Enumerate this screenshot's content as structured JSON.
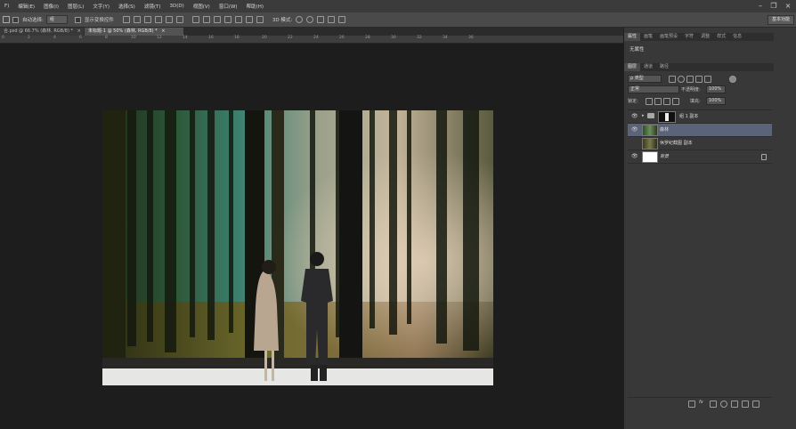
{
  "menu": {
    "items": [
      "F)",
      "编辑(E)",
      "图像(I)",
      "图层(L)",
      "文字(Y)",
      "选择(S)",
      "滤镜(T)",
      "3D(D)",
      "视图(V)",
      "窗口(W)",
      "帮助(H)"
    ],
    "minimize": "–",
    "restore": "❐",
    "close": "×"
  },
  "options": {
    "auto_select_label": "自动选择:",
    "auto_select_value": "组",
    "show_transform_label": "显示变换控件",
    "mode_3d_label": "3D 模式:",
    "workspace": "基本功能"
  },
  "doc_tabs": [
    {
      "label": "合.psd @ 66.7% (森林, RGB/8) *",
      "close": "×"
    },
    {
      "label": "未标题-1 @ 50% (森林, RGB/8) *",
      "close": "×"
    }
  ],
  "ruler": [
    "0",
    "2",
    "4",
    "6",
    "8",
    "10",
    "12",
    "14",
    "16",
    "18",
    "20",
    "22",
    "24",
    "26",
    "28",
    "30",
    "32",
    "34",
    "36"
  ],
  "properties_panel": {
    "tabs": [
      "属性",
      "画笔",
      "画笔预设",
      "字符",
      "调整",
      "样式",
      "信息"
    ],
    "empty_text": "无属性"
  },
  "layers_panel": {
    "tabs": [
      "图层",
      "通道",
      "路径"
    ],
    "filter_kind": "ρ 类型",
    "blend_mode": "正常",
    "opacity_label": "不透明度:",
    "opacity_value": "100%",
    "lock_label": "锁定:",
    "fill_label": "填充:",
    "fill_value": "100%",
    "layers": [
      {
        "name": "组 1 副本",
        "type": "group",
        "selected": false,
        "visible": true
      },
      {
        "name": "森林",
        "type": "image",
        "selected": true,
        "visible": true
      },
      {
        "name": "休罗纪截图 副本",
        "type": "image",
        "selected": false,
        "visible": false
      },
      {
        "name": "背景",
        "type": "background",
        "selected": false,
        "visible": true
      }
    ],
    "footer_icons": [
      "link-icon",
      "fx-icon",
      "mask-icon",
      "adjustment-icon",
      "folder-icon",
      "new-layer-icon",
      "trash-icon"
    ],
    "fx_label": "fx"
  },
  "colors": {
    "selection": "#5a6378",
    "canvas_bg": "#1d1d1d",
    "panel_bg": "#383838"
  }
}
